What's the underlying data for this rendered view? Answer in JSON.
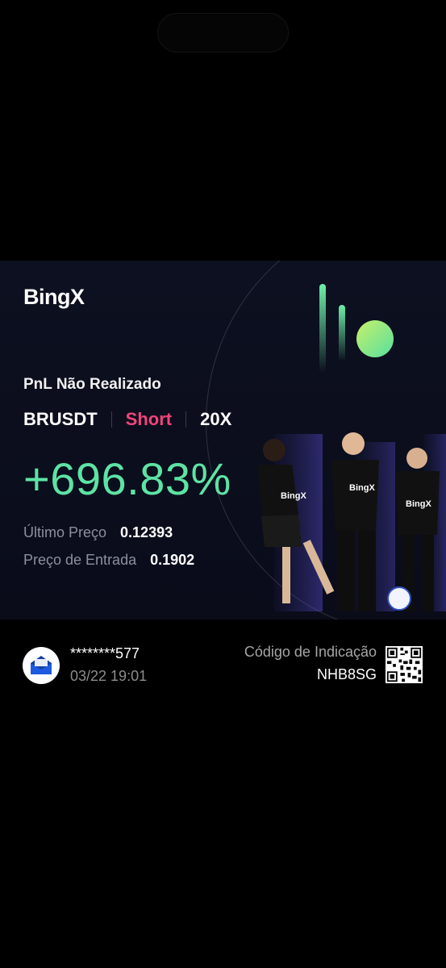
{
  "brand": {
    "logo": "BingX"
  },
  "card": {
    "pnl_label": "PnL Não Realizado",
    "pair": "BRUSDT",
    "side": "Short",
    "leverage": "20X",
    "pnl_percent": "+696.83%",
    "last_price_label": "Último Preço",
    "last_price": "0.12393",
    "entry_price_label": "Preço de Entrada",
    "entry_price": "0.1902",
    "player_shirt_text": "BingX"
  },
  "footer": {
    "user": "********577",
    "date": "03/22 19:01",
    "referral_label": "Código de Indicação",
    "referral_code": "NHB8SG"
  },
  "colors": {
    "profit": "#5de3a4",
    "short": "#f0457a",
    "background": "#000000",
    "card": "#0d1020"
  }
}
